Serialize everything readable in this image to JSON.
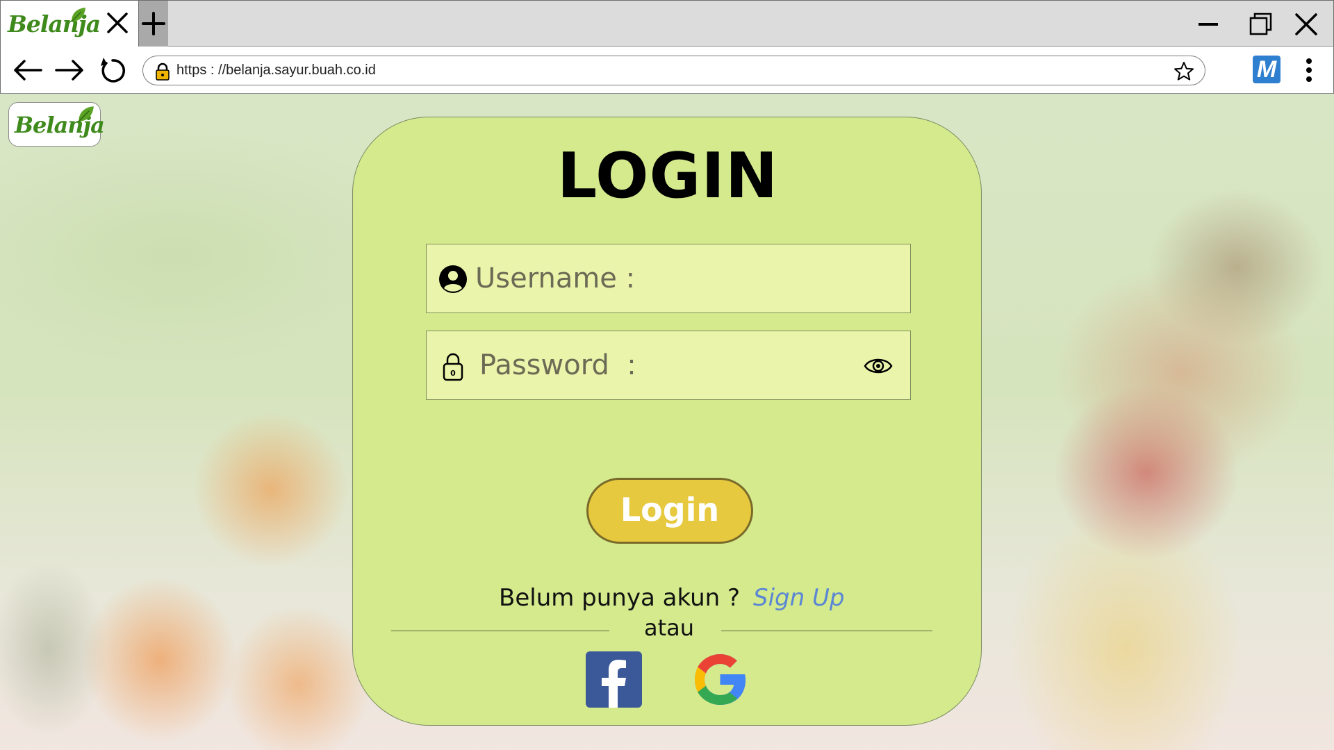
{
  "browser": {
    "tab": {
      "logo_text": "Belanja"
    },
    "url": "https : //belanja.sayur.buah.co.id",
    "extension_label": "M"
  },
  "page": {
    "logo_text": "Belanja",
    "title": "LOGIN",
    "username_label": "Username :",
    "password_label": "Password  :",
    "login_button": "Login",
    "signup_prompt": "Belum punya akun ?",
    "signup_link": "Sign Up",
    "divider_text": "atau",
    "social": [
      {
        "name": "facebook",
        "icon": "facebook-icon",
        "color": "#3b5998"
      },
      {
        "name": "google",
        "icon": "google-icon"
      }
    ]
  },
  "colors": {
    "card_bg": "#d4ea8d",
    "field_bg": "#eaf5ab",
    "login_button_bg": "#e6c93e",
    "signup_link": "#5b86d4",
    "brand_green": "#3f8a1c"
  }
}
